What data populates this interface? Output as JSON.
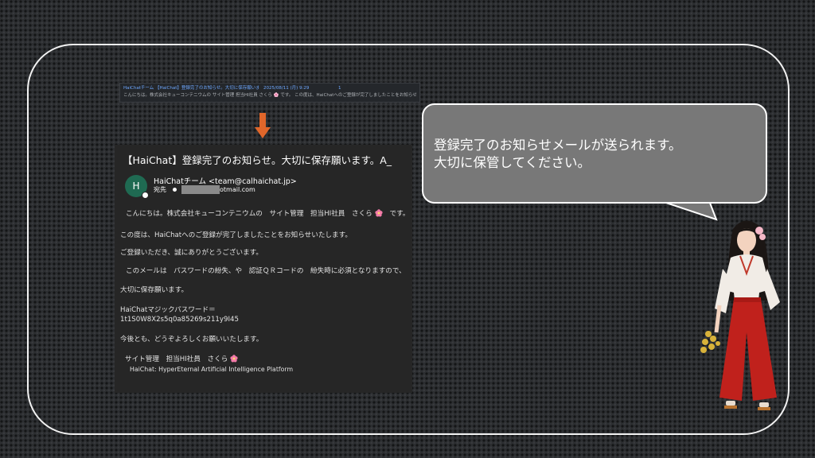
{
  "mail_list": {
    "row1_subject": "HaiChatチーム 【HaiChat】登録完了のお知らせ。大切に保存願います。A_",
    "row1_date": "2025/08/11 (月) 9:29",
    "row1_mark": "1",
    "row2_preview": "こんにちは。株式会社キューコンテニウムの サイト管理 担当HI社員 さくら 🌸 です。 この度は、HaiChatへのご登録が完了しましたことをお知らせいたします。 ご登録いただき、誠にありがとうございます。 このメールは パスワードの紛失、"
  },
  "email": {
    "subject": "【HaiChat】登録完了のお知らせ。大切に保存願います。A_",
    "avatar_initial": "H",
    "sender": "HaiChatチーム <team@calhaichat.jp>",
    "to_label": "宛先",
    "to_suffix": "otmail.com",
    "lines": [
      "こんにちは。株式会社キューコンテニウムの　サイト管理　担当HI社員　さくら",
      "です。",
      "この度は、HaiChatへのご登録が完了しましたことをお知らせいたします。",
      "ご登録いただき、誠にありがとうございます。",
      "このメールは　パスワードの紛失、や　認証ＱＲコードの　紛失時に必須となりますので、",
      "大切に保存願います。",
      "HaiChatマジックパスワード＝",
      "1t1S0W8X2s5q0a85269s211y9I45",
      "今後とも、どうぞよろしくお願いいたします。",
      "サイト管理　担当HI社員　さくら",
      "HaiChat: HyperEternal Artificial Intelligence Platform"
    ]
  },
  "bubble": {
    "line1": "登録完了のお知らせメールが送られます。",
    "line2": "大切に保管してください。"
  },
  "colors": {
    "avatar": "#1f6a52",
    "bubble": "#787878",
    "arrow": "#e0662a",
    "link_blue": "#6ea8ff"
  },
  "icons": [
    "arrow-down-icon",
    "flower-icon",
    "shrine-maiden-illustration"
  ]
}
